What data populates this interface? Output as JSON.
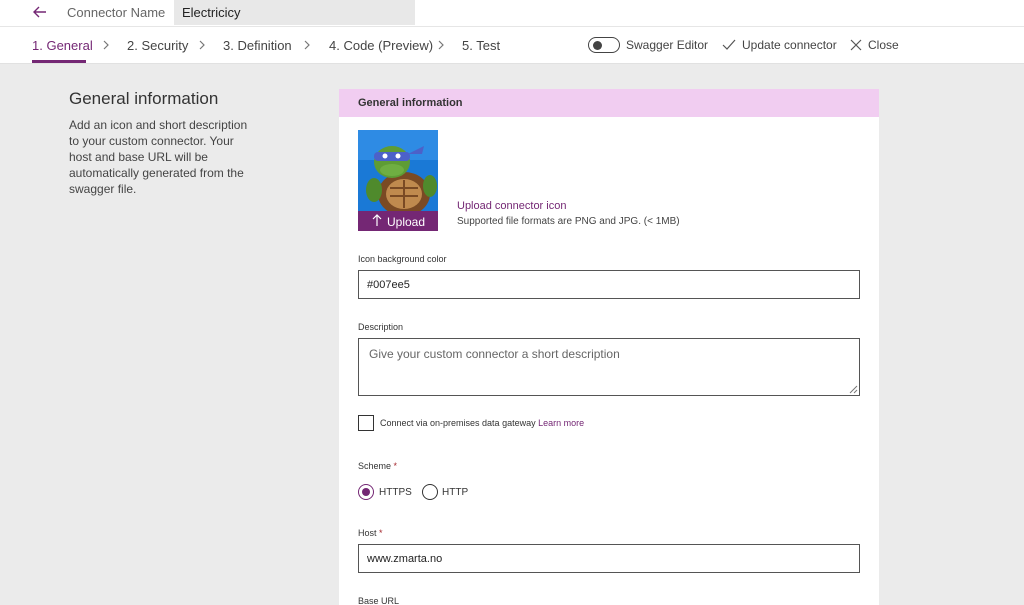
{
  "topbar": {
    "connector_name_label": "Connector Name",
    "connector_name_value": "Electricicy"
  },
  "steps": [
    {
      "label": "1. General",
      "active": true
    },
    {
      "label": "2. Security",
      "active": false
    },
    {
      "label": "3. Definition",
      "active": false
    },
    {
      "label": "4. Code (Preview)",
      "active": false
    },
    {
      "label": "5. Test",
      "active": false
    }
  ],
  "actions": {
    "swagger_editor_label": "Swagger Editor",
    "swagger_editor_on": false,
    "update_label": "Update connector",
    "close_label": "Close"
  },
  "left_panel": {
    "title": "General information",
    "description": "Add an icon and short description to your custom connector. Your host and base URL will be automatically generated from the swagger file."
  },
  "card": {
    "header": "General information",
    "upload_button": "Upload",
    "upload_link": "Upload connector icon",
    "upload_formats": "Supported file formats are PNG and JPG. (< 1MB)",
    "icon_bg_label": "Icon background color",
    "icon_bg_value": "#007ee5",
    "description_label": "Description",
    "description_placeholder": "Give your custom connector a short description",
    "gateway_label": "Connect via on-premises data gateway",
    "gateway_learn_more": "Learn more",
    "gateway_checked": false,
    "scheme_label": "Scheme",
    "scheme_options": [
      "HTTPS",
      "HTTP"
    ],
    "scheme_selected": "HTTPS",
    "host_label": "Host",
    "host_value": "www.zmarta.no",
    "base_url_label": "Base URL",
    "required_mark": "*"
  },
  "colors": {
    "accent": "#742774",
    "header_bg": "#f1cdf1",
    "page_bg": "#ebebeb"
  }
}
